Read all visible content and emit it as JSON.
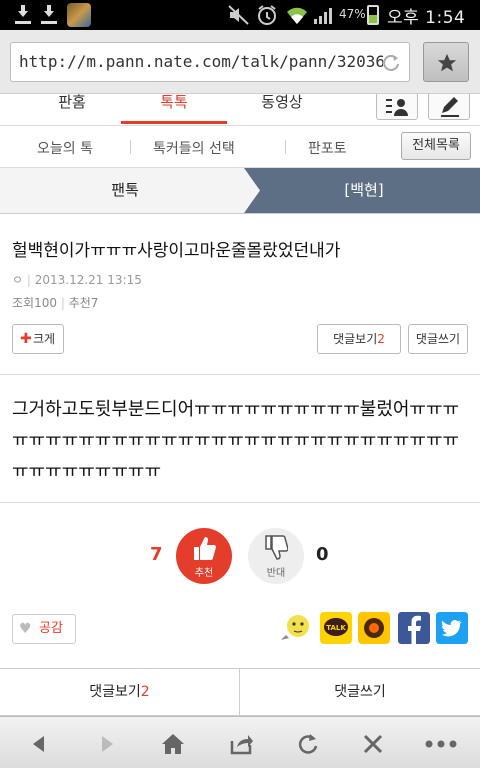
{
  "statusbar": {
    "battery_pct": "47%",
    "clock": "오후 1:54",
    "battery_level": 0.47,
    "icons": [
      "download-icon",
      "download-icon",
      "app-icon",
      "mute-icon",
      "alarm-icon",
      "wifi-icon",
      "signal-icon",
      "battery-icon"
    ]
  },
  "urlbar": {
    "url": "http://m.pann.nate.com/talk/pann/32036",
    "reload_icon": "reload-icon",
    "bookmark_icon": "star-icon"
  },
  "nav": {
    "items": [
      {
        "label": "판홈"
      },
      {
        "label": "톡톡"
      },
      {
        "label": "동영상"
      }
    ],
    "active_index": 1,
    "icons": [
      "my-profile-icon",
      "write-icon"
    ]
  },
  "subnav": {
    "items": [
      {
        "label": "오늘의 톡"
      },
      {
        "label": "톡커들의 선택"
      },
      {
        "label": "판포토"
      }
    ],
    "all_label": "전체목록"
  },
  "breadcrumb": {
    "parent": "팬톡",
    "current": "[백현]"
  },
  "post": {
    "title": "헐백현이가ㅠㅠㅠ사랑이고마운줄몰랐었던내가",
    "author_marker": "ㅇ",
    "date": "2013.12.21 13:15",
    "views_label": "조회",
    "views": "100",
    "recommend_label": "추천",
    "recommend": "7",
    "zoom_label": "크게",
    "comment_view_label": "댓글보기",
    "comment_count": "2",
    "comment_write_label": "댓글쓰기",
    "body": "그거하고도뒷부분드디어ㅠㅠㅠㅠㅠㅠㅠㅠㅠㅠ불렀어ㅠㅠㅠㅠㅠㅠㅠㅠㅠㅠㅠㅠㅠㅠㅠㅠㅠㅠㅠㅠㅠㅠㅠㅠㅠㅠㅠㅠㅠㅠㅠㅠㅠㅠㅠㅠㅠㅠㅠ"
  },
  "votes": {
    "up_count": "7",
    "up_label": "추천",
    "down_label": "반대",
    "down_count": "0"
  },
  "share": {
    "empathy_label": "공감",
    "services": [
      "thinking-emoticon-icon",
      "kakaotalk-icon",
      "kakaostory-icon",
      "facebook-icon",
      "twitter-icon"
    ]
  },
  "bottombar": {
    "view_label": "댓글보기",
    "count": "2",
    "write_label": "댓글쓰기"
  },
  "toolbar": {
    "icons": [
      "back-icon",
      "forward-icon",
      "home-icon",
      "share-icon",
      "refresh-icon",
      "close-icon",
      "more-icon"
    ]
  },
  "colors": {
    "accent": "#e53d2b",
    "breadcrumb_active": "#5d6f84",
    "facebook": "#3b5998",
    "twitter": "#1da1f2",
    "kakao": "#ffd400"
  }
}
